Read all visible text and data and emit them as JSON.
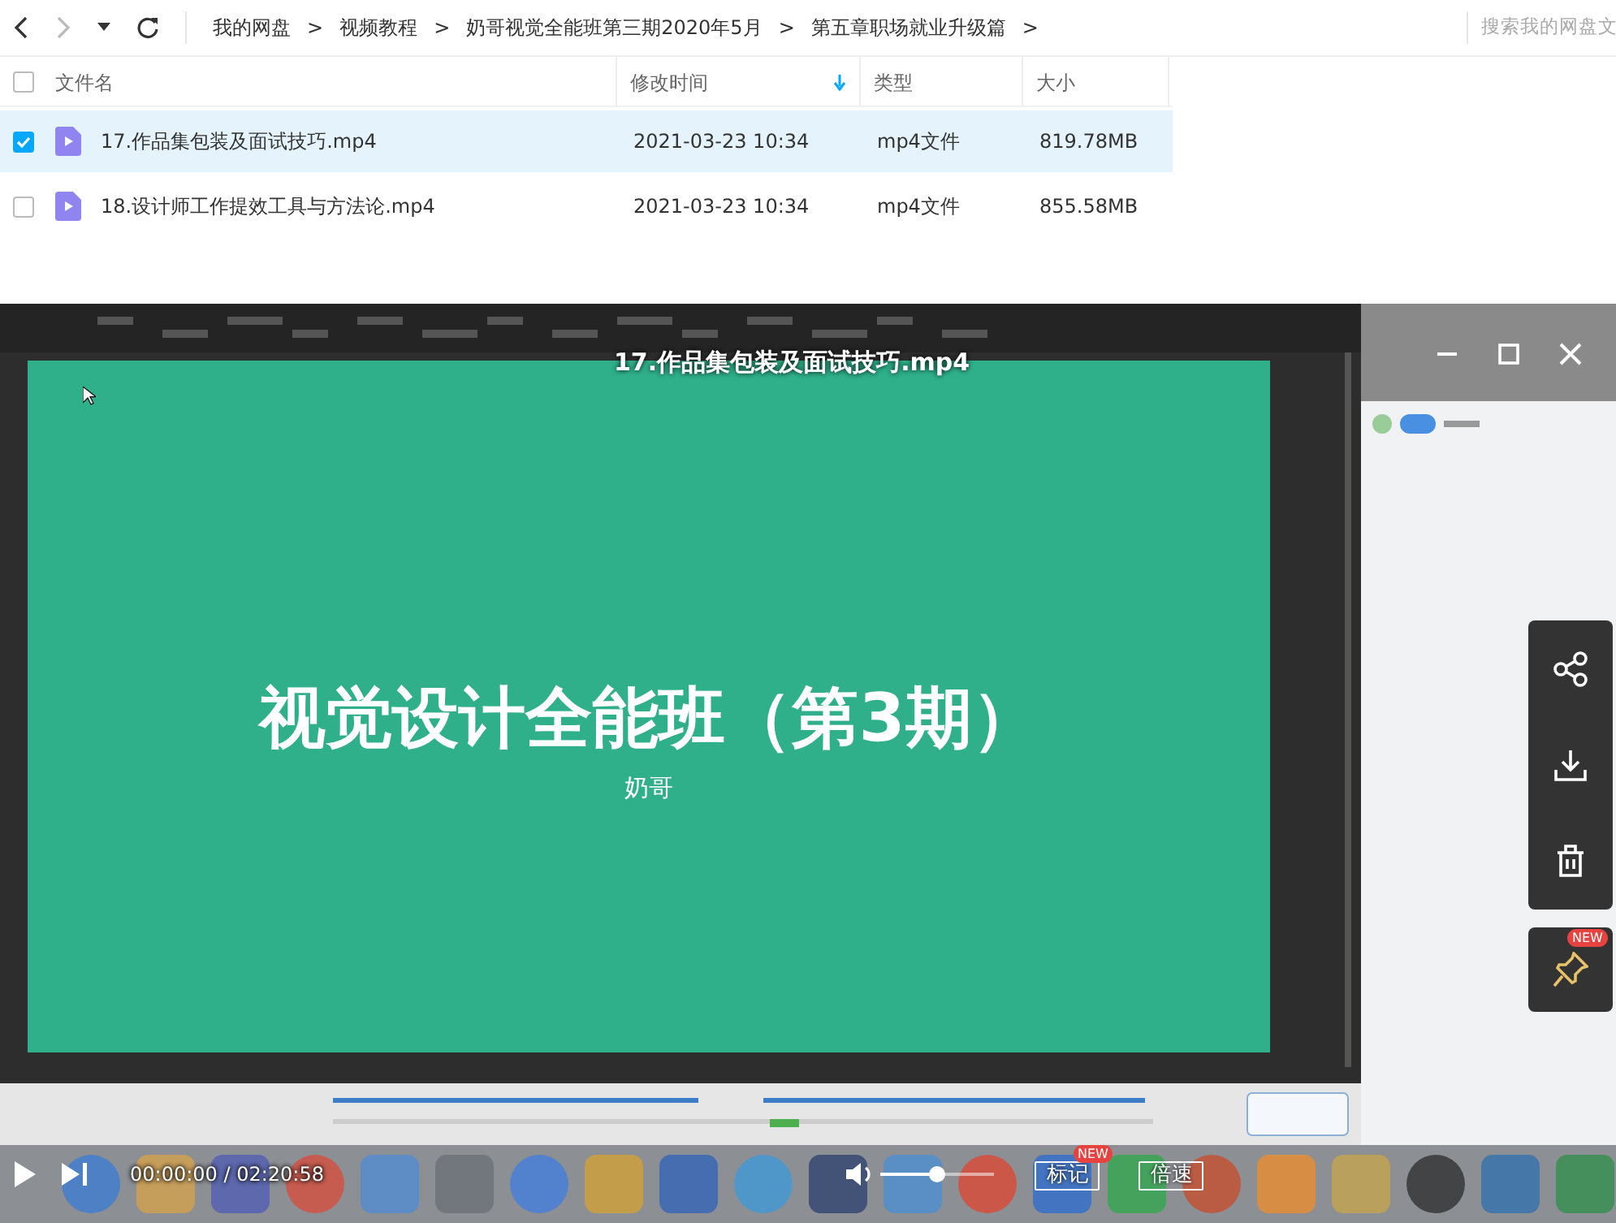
{
  "breadcrumb": {
    "separator": ">",
    "items": [
      "我的网盘",
      "视频教程",
      "奶哥视觉全能班第三期2020年5月",
      "第五章职场就业升级篇"
    ]
  },
  "search": {
    "placeholder": "搜索我的网盘文"
  },
  "table": {
    "select_all": {
      "checked": false
    },
    "columns": [
      {
        "label": "文件名",
        "sorted": false
      },
      {
        "label": "修改时间",
        "sorted": true
      },
      {
        "label": "类型",
        "sorted": false
      },
      {
        "label": "大小",
        "sorted": false
      }
    ],
    "rows": [
      {
        "name": "17.作品集包装及面试技巧.mp4",
        "modified": "2021-03-23 10:34",
        "type": "mp4文件",
        "size": "819.78MB",
        "selected": true
      },
      {
        "name": "18.设计师工作提效工具与方法论.mp4",
        "modified": "2021-03-23 10:34",
        "type": "mp4文件",
        "size": "855.58MB",
        "selected": false
      }
    ]
  },
  "player": {
    "title": "17.作品集包装及面试技巧.mp4",
    "slide": {
      "title": "视觉设计全能班（第3期）",
      "subtitle": "奶哥"
    },
    "time": "00:00:00 / 02:20:58",
    "volume": {
      "level": 0.49
    },
    "buttons": [
      {
        "label": "标记",
        "badge": "NEW"
      },
      {
        "label": "倍速"
      }
    ],
    "side_actions": {
      "pin_badge": "NEW"
    }
  }
}
